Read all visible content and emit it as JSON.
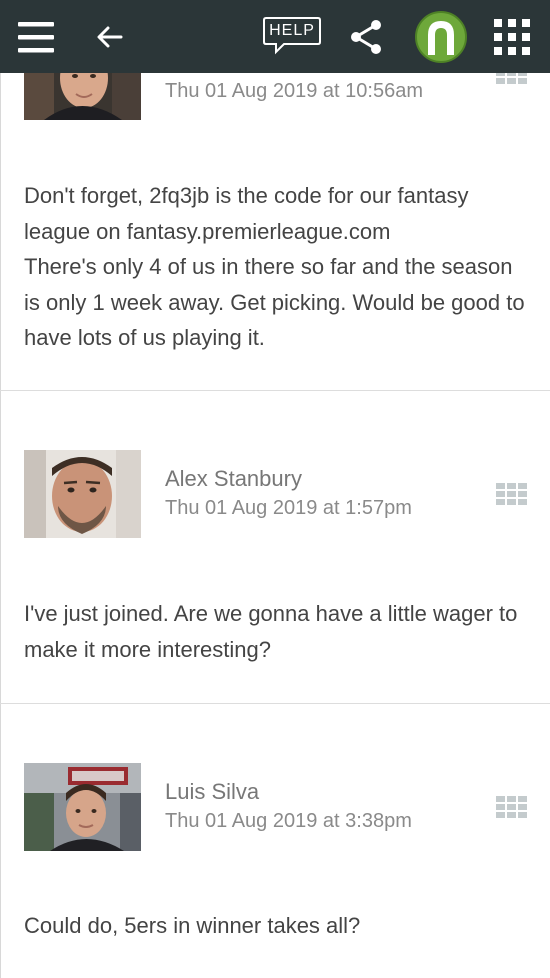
{
  "header": {
    "menu_icon": "hamburger-menu-icon",
    "back_icon": "back-arrow-icon",
    "help_label": "HELP",
    "share_icon": "share-icon",
    "avatar_icon": "horseshoe-avatar-icon",
    "apps_icon": "apps-grid-icon",
    "bar_color": "#2b3638",
    "avatar_color": "#6ea83a"
  },
  "posts": [
    {
      "author": "",
      "date": "Thu 01 Aug 2019 at 10:56am",
      "body_lines": [
        "Don't forget, 2fq3jb is the code for our fantasy league on fantasy.premierleague.com",
        "There's only 4 of us in there so far and the season is only 1 week away. Get picking. Would be good to have lots of us playing it."
      ]
    },
    {
      "author": "Alex Stanbury",
      "date": "Thu 01 Aug 2019 at 1:57pm",
      "body_lines": [
        "I've just joined. Are we gonna have a little wager to make it more interesting?"
      ]
    },
    {
      "author": "Luis Silva",
      "date": "Thu 01 Aug 2019 at 3:38pm",
      "body_lines": [
        "Could do, 5ers in winner takes all?"
      ]
    }
  ]
}
